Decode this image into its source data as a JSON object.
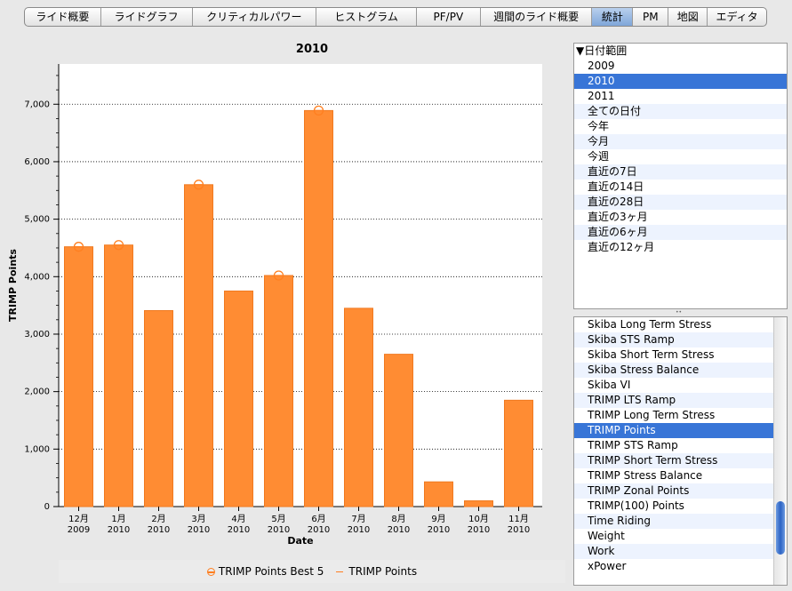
{
  "tabs": [
    {
      "label": "ライド概要",
      "active": false
    },
    {
      "label": "ライドグラフ",
      "active": false
    },
    {
      "label": "クリティカルパワー",
      "active": false
    },
    {
      "label": "ヒストグラム",
      "active": false
    },
    {
      "label": "PF/PV",
      "active": false
    },
    {
      "label": "週間のライド概要",
      "active": false
    },
    {
      "label": "統計",
      "active": true
    },
    {
      "label": "PM",
      "active": false
    },
    {
      "label": "地図",
      "active": false
    },
    {
      "label": "エディタ",
      "active": false
    }
  ],
  "chart_data": {
    "type": "bar",
    "title": "2010",
    "xlabel": "Date",
    "ylabel": "TRIMP Points",
    "ylim": [
      0,
      7700
    ],
    "yticks": [
      0,
      1000,
      2000,
      3000,
      4000,
      5000,
      6000,
      7000
    ],
    "ytick_labels": [
      "0",
      "1,000",
      "2,000",
      "3,000",
      "4,000",
      "5,000",
      "6,000",
      "7,000"
    ],
    "categories": [
      {
        "month": "12月",
        "year": "2009"
      },
      {
        "month": "1月",
        "year": "2010"
      },
      {
        "month": "2月",
        "year": "2010"
      },
      {
        "month": "3月",
        "year": "2010"
      },
      {
        "month": "4月",
        "year": "2010"
      },
      {
        "month": "5月",
        "year": "2010"
      },
      {
        "month": "6月",
        "year": "2010"
      },
      {
        "month": "7月",
        "year": "2010"
      },
      {
        "month": "8月",
        "year": "2010"
      },
      {
        "month": "9月",
        "year": "2010"
      },
      {
        "month": "10月",
        "year": "2010"
      },
      {
        "month": "11月",
        "year": "2010"
      }
    ],
    "series": [
      {
        "name": "TRIMP Points",
        "values": [
          4520,
          4550,
          3410,
          5600,
          3750,
          4020,
          6890,
          3450,
          2650,
          430,
          100,
          1850
        ]
      },
      {
        "name": "TRIMP Points Best 5",
        "values": [
          4520,
          4550,
          null,
          5600,
          null,
          4020,
          6890,
          null,
          null,
          null,
          null,
          null
        ]
      }
    ],
    "bar_color": "#ff8c33",
    "marker_color": "#ff7f20",
    "grid": true,
    "legend_position": "bottom"
  },
  "legend": {
    "best5_label": "TRIMP Points Best 5",
    "points_label": "TRIMP Points"
  },
  "date_range": {
    "header": "▼日付範囲",
    "items": [
      "2009",
      "2010",
      "2011",
      "全ての日付",
      "今年",
      "今月",
      "今週",
      "直近の7日",
      "直近の14日",
      "直近の28日",
      "直近の3ヶ月",
      "直近の6ヶ月",
      "直近の12ヶ月"
    ],
    "selected": "2010"
  },
  "metrics": {
    "items": [
      "Skiba Long Term Stress",
      "Skiba STS Ramp",
      "Skiba Short Term Stress",
      "Skiba Stress Balance",
      "Skiba VI",
      "TRIMP LTS Ramp",
      "TRIMP Long Term Stress",
      "TRIMP Points",
      "TRIMP STS Ramp",
      "TRIMP Short Term Stress",
      "TRIMP Stress Balance",
      "TRIMP Zonal Points",
      "TRIMP(100) Points",
      "Time Riding",
      "Weight",
      "Work",
      "xPower"
    ],
    "selected": "TRIMP Points"
  }
}
